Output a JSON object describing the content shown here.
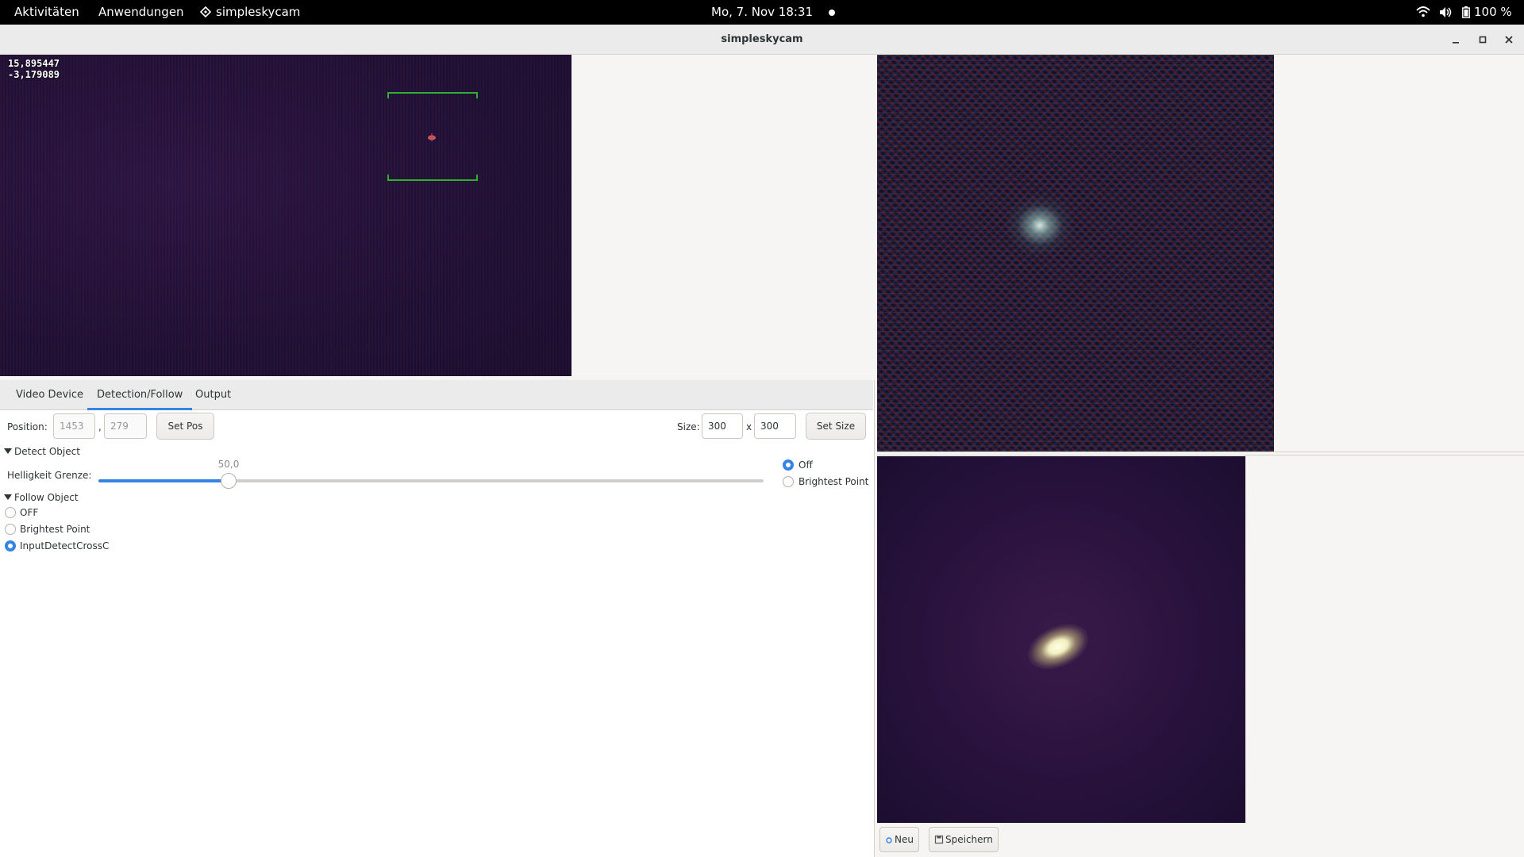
{
  "topbar": {
    "activities": "Aktivitäten",
    "applications": "Anwendungen",
    "app_name": "simpleskycam",
    "clock": "Mo,  7. Nov  18:31",
    "battery": "100 %",
    "icons": [
      "network-wifi-icon",
      "volume-icon",
      "battery-icon"
    ]
  },
  "window": {
    "title": "simpleskycam"
  },
  "video": {
    "coord_line1": "15,895447",
    "coord_line2": "-3,179089",
    "detection_box_color": "#2fae2f",
    "target_marker_color": "#ff3030"
  },
  "tabs": [
    {
      "label": "Video Device",
      "active": false
    },
    {
      "label": "Detection/Follow",
      "active": true
    },
    {
      "label": "Output",
      "active": false
    }
  ],
  "detection": {
    "position_label": "Position:",
    "pos_x": "1453",
    "pos_sep": ",",
    "pos_y": "279",
    "set_pos": "Set Pos",
    "size_label": "Size:",
    "size_w": "300",
    "size_x": "x",
    "size_h": "300",
    "set_size": "Set Size",
    "detect_object": "Detect Object",
    "brightness_label": "Helligkeit Grenze:",
    "slider_value": "50,0",
    "slider_fraction": 0.196,
    "detect_mode_options": [
      {
        "label": "Off",
        "selected": true
      },
      {
        "label": "Brightest Point",
        "selected": false
      }
    ],
    "follow_object": "Follow Object",
    "follow_options": [
      {
        "label": "OFF",
        "selected": false
      },
      {
        "label": "Brightest Point",
        "selected": false
      },
      {
        "label": "InputDetectCrossC",
        "selected": true
      }
    ]
  },
  "actions": {
    "new_label": "Neu",
    "save_label": "Speichern"
  },
  "colors": {
    "accent": "#3584e4",
    "topbar_bg": "#000000",
    "window_bg": "#f6f5f4"
  }
}
